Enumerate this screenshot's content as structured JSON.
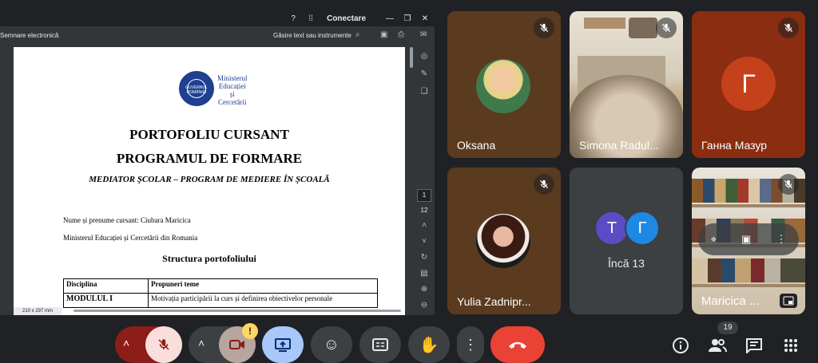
{
  "window": {
    "title": "Conectare"
  },
  "doc_toolbar": {
    "left_label": "Semnare electronică",
    "search_label": "Găsire text sau instrumente"
  },
  "document": {
    "ministry_lines": [
      "Ministerul",
      "Educației",
      "și",
      "Cercetării"
    ],
    "crest_text": "GUVERNUL ROMÂNIEI",
    "title_line1": "PORTOFOLIU CURSANT",
    "title_line2": "PROGRAMUL DE FORMARE",
    "subtitle": "MEDIATOR ȘCOLAR – PROGRAM DE MEDIERE ÎN ȘCOALĂ",
    "name_line": "Nume și prenume cursant: Ciubara Maricica",
    "ministry_line": "Ministerul Educației și Cercetării din Romania",
    "section_title": "Structura portofoliului",
    "table": {
      "headers": [
        "Disciplina",
        "Propuneri teme"
      ],
      "rows": [
        [
          "MODULUL I",
          "Motivația participării la curs și definirea obiectivelor personale"
        ]
      ]
    },
    "page_size": "210 x 297 mm"
  },
  "pager": {
    "current_page": "1",
    "total_pages": "12"
  },
  "participants": [
    {
      "name": "Oksana",
      "muted": true
    },
    {
      "name": "Simona Radul...",
      "muted": true
    },
    {
      "name": "Ганна Мазур",
      "muted": true,
      "initial": "Г",
      "color": "#c5411c"
    },
    {
      "name": "Yulia Zadnipr...",
      "muted": true
    },
    {
      "overflow_label": "Încă 13",
      "initials": [
        "T",
        "Г"
      ],
      "colors": [
        "#5b4bc4",
        "#1e88e5"
      ]
    },
    {
      "name": "Maricica ...",
      "muted": true
    }
  ],
  "controls": {
    "participant_count": "19",
    "leave_color": "#ea4335",
    "mic_muted_color": "#f9dedc",
    "present_color": "#a8c7fa",
    "warning_color": "#fdd663"
  }
}
